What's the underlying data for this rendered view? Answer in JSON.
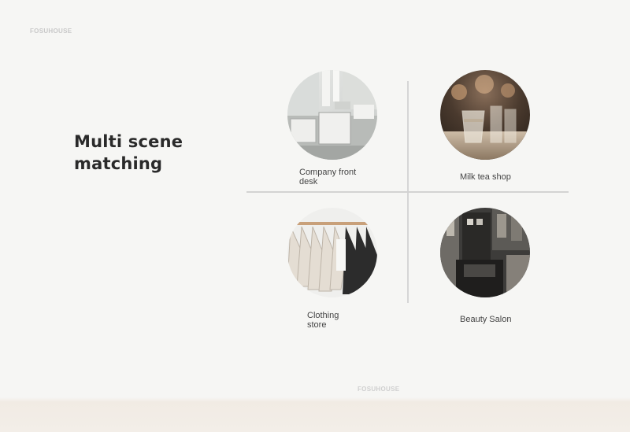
{
  "brand": {
    "top": "FOSUHOUSE",
    "bottom": "FOSUHOUSE"
  },
  "headline": {
    "line1": "Multi scene",
    "line2": "matching"
  },
  "scenes": [
    {
      "label_line1": "Company front",
      "label_line2": "desk",
      "image": "office-desk-photo"
    },
    {
      "label_line1": "Milk tea shop",
      "label_line2": "",
      "image": "glass-cups-photo"
    },
    {
      "label_line1": "Clothing",
      "label_line2": "store",
      "image": "clothes-hangers-photo"
    },
    {
      "label_line1": "Beauty Salon",
      "label_line2": "",
      "image": "salon-interior-photo"
    }
  ]
}
